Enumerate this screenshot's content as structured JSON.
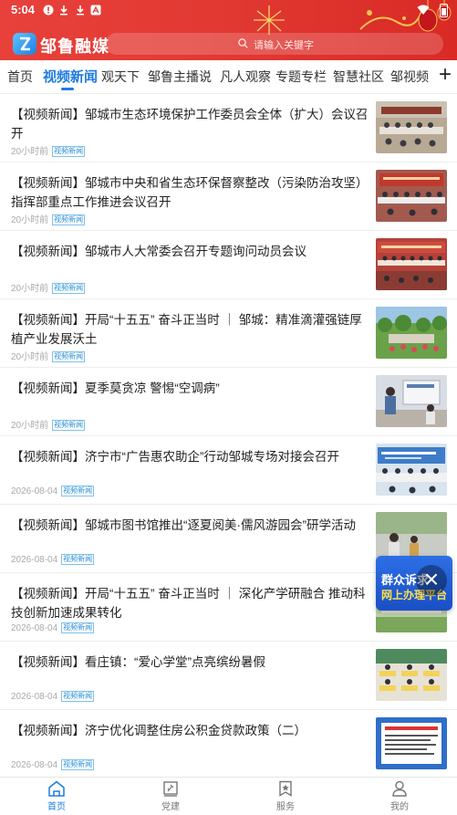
{
  "status_bar": {
    "time": "5:04",
    "icons": [
      "alert-icon",
      "download-icon",
      "download-icon",
      "app-icon"
    ]
  },
  "app": {
    "name": "邹鲁融媒"
  },
  "search": {
    "placeholder": "请输入关键字"
  },
  "tabs": [
    {
      "label": "首页"
    },
    {
      "label": "视频新闻",
      "active": true
    },
    {
      "label": "观天下"
    },
    {
      "label": "邹鲁主播说"
    },
    {
      "label": "凡人观察"
    },
    {
      "label": "专题专栏"
    },
    {
      "label": "智慧社区"
    },
    {
      "label": "邹视频"
    }
  ],
  "feed": [
    {
      "title": "【视频新闻】邹城市生态环境保护工作委员会全体（扩大）会议召开",
      "time": "20小时前",
      "tag": "视频新闻"
    },
    {
      "title": "【视频新闻】邹城市中央和省生态环保督察整改（污染防治攻坚）指挥部重点工作推进会议召开",
      "time": "20小时前",
      "tag": "视频新闻"
    },
    {
      "title": "【视频新闻】邹城市人大常委会召开专题询问动员会议",
      "time": "20小时前",
      "tag": "视频新闻"
    },
    {
      "title": "【视频新闻】开局“十五五” 奋斗正当时 ｜ 邹城：精准滴灌强链厚植产业发展沃土",
      "time": "20小时前",
      "tag": "视频新闻"
    },
    {
      "title": "【视频新闻】夏季莫贪凉 警惕“空调病”",
      "time": "20小时前",
      "tag": "视频新闻"
    },
    {
      "title": "【视频新闻】济宁市“广告惠农助企”行动邹城专场对接会召开",
      "time": "2026-08-04",
      "tag": "视频新闻"
    },
    {
      "title": "【视频新闻】邹城市图书馆推出“逐夏阅美·儒风游园会”研学活动",
      "time": "2026-08-04",
      "tag": "视频新闻"
    },
    {
      "title": "【视频新闻】开局“十五五” 奋斗正当时 ｜ 深化产学研融合 推动科技创新加速成果转化",
      "time": "2026-08-04",
      "tag": "视频新闻"
    },
    {
      "title": "【视频新闻】看庄镇：“爱心学堂”点亮缤纷暑假",
      "time": "2026-08-04",
      "tag": "视频新闻"
    },
    {
      "title": "【视频新闻】济宁优化调整住房公积金贷款政策（二）",
      "time": "2026-08-04",
      "tag": "视频新闻"
    }
  ],
  "float_ad": {
    "line1": "群众诉求",
    "line2": "网上办理平台"
  },
  "bottom_nav": [
    {
      "label": "首页",
      "icon": "home-icon",
      "active": true
    },
    {
      "label": "党建",
      "icon": "party-icon"
    },
    {
      "label": "服务",
      "icon": "service-icon"
    },
    {
      "label": "我的",
      "icon": "user-icon"
    }
  ],
  "colors": {
    "header_red": "#e23a33",
    "accent_blue": "#1e7be0"
  }
}
